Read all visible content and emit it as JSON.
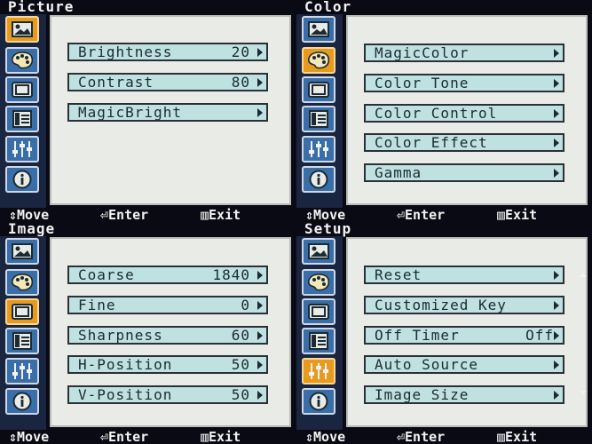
{
  "footer": {
    "move": "⇕Move",
    "enter": "⏎Enter",
    "exit": "▥Exit"
  },
  "panels": [
    {
      "title": "Picture",
      "active_icon": "picture-icon",
      "items": [
        {
          "label": "Brightness",
          "value": "20"
        },
        {
          "label": "Contrast",
          "value": "80"
        },
        {
          "label": "MagicBright",
          "value": ""
        }
      ]
    },
    {
      "title": "Color",
      "active_icon": "color-palette-icon",
      "items": [
        {
          "label": "MagicColor",
          "value": ""
        },
        {
          "label": "Color Tone",
          "value": ""
        },
        {
          "label": "Color Control",
          "value": ""
        },
        {
          "label": "Color Effect",
          "value": ""
        },
        {
          "label": "Gamma",
          "value": ""
        }
      ]
    },
    {
      "title": "Image",
      "active_icon": "image-icon",
      "items": [
        {
          "label": "Coarse",
          "value": "1840"
        },
        {
          "label": "Fine",
          "value": "0"
        },
        {
          "label": "Sharpness",
          "value": "60"
        },
        {
          "label": "H-Position",
          "value": "50"
        },
        {
          "label": "V-Position",
          "value": "50"
        }
      ]
    },
    {
      "title": "Setup",
      "active_icon": "setup-sliders-icon",
      "items": [
        {
          "label": "Reset",
          "value": ""
        },
        {
          "label": "Customized Key",
          "value": ""
        },
        {
          "label": "Off Timer",
          "value": "Off"
        },
        {
          "label": "Auto Source",
          "value": ""
        },
        {
          "label": "Image Size",
          "value": ""
        }
      ]
    }
  ],
  "icons": [
    "picture-icon",
    "color-palette-icon",
    "image-icon",
    "osd-icon",
    "setup-sliders-icon",
    "information-icon"
  ],
  "colors": {
    "icon_normal": "#3a6ea8",
    "icon_active": "#e89a1e",
    "item_bg": "#bfe2e0",
    "content_bg": "#e9ebe7"
  }
}
